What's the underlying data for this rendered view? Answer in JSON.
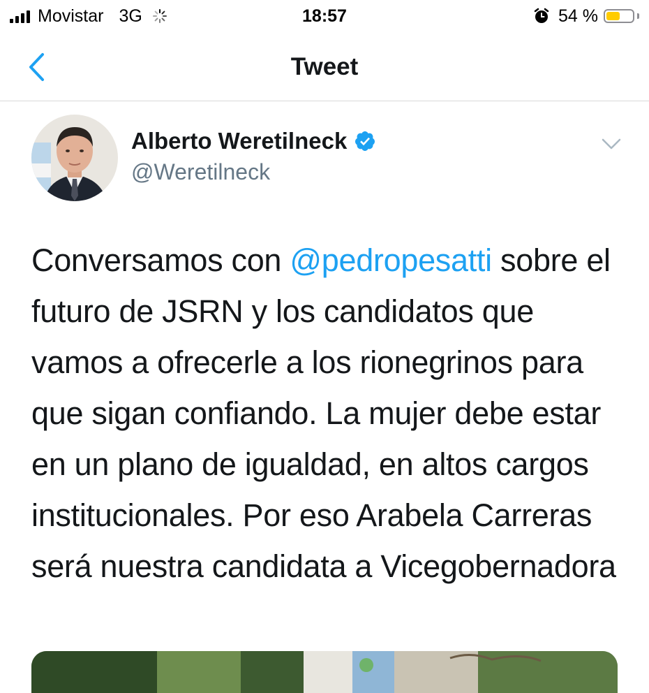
{
  "status_bar": {
    "carrier": "Movistar",
    "network": "3G",
    "time": "18:57",
    "battery_percent_label": "54 %",
    "battery_level": 0.54,
    "colors": {
      "battery_fill": "#ffcc00"
    }
  },
  "nav": {
    "back_icon": "chevron-left-icon",
    "title": "Tweet"
  },
  "tweet": {
    "author": {
      "name": "Alberto Weretilneck",
      "handle": "@Weretilneck",
      "verified": true
    },
    "text": {
      "before_mention": "Conversamos con ",
      "mention": "@pedropesatti",
      "after_mention": " sobre el futuro de JSRN y los candidatos que vamos a ofrecerle a los rionegrinos para que sigan confiando. La mujer debe estar en un plano de igualdad, en altos cargos institucionales. Por eso Arabela Carreras será nuestra candidata a Vicegobernadora"
    },
    "menu_icon": "chevron-down-icon"
  },
  "colors": {
    "accent": "#1da1f2",
    "text_primary": "#14171a",
    "text_secondary": "#657786",
    "divider": "#d8d8d8"
  }
}
